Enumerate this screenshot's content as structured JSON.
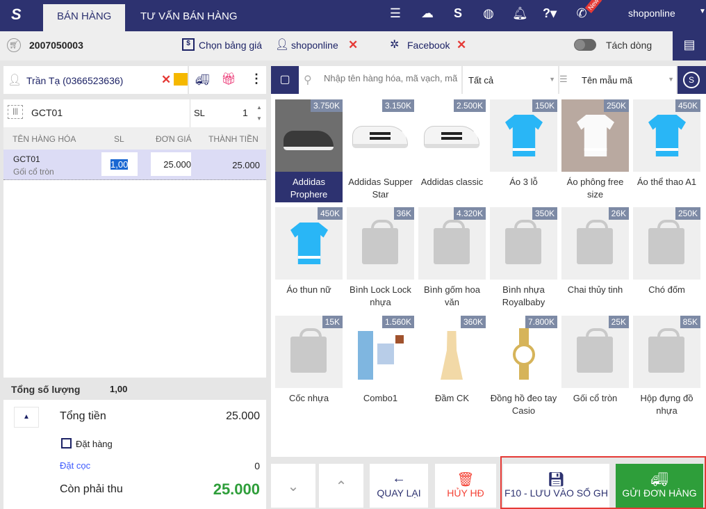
{
  "header": {
    "tabs": [
      "BÁN HÀNG",
      "TƯ VẤN BÁN HÀNG"
    ],
    "user": "shoponline",
    "new_badge": "New"
  },
  "toolbar": {
    "order_code": "2007050003",
    "price_list": "Chọn bảng giá",
    "seller": "shoponline",
    "channel": "Facebook",
    "split_lines": "Tách dòng",
    "split_lines_on": false
  },
  "customer": {
    "name": "Trần Tạ (0366523636)"
  },
  "scan": {
    "value": "GCT01",
    "qty_label": "SL",
    "qty": "1"
  },
  "table": {
    "headers": [
      "TÊN HÀNG HÓA",
      "SL",
      "ĐƠN GIÁ",
      "THÀNH TIỀN"
    ],
    "rows": [
      {
        "code": "GCT01",
        "name": "Gối cổ tròn",
        "qty": "1,00",
        "price": "25.000",
        "total": "25.000"
      }
    ]
  },
  "summary": {
    "total_qty_label": "Tổng số lượng",
    "total_qty": "1,00",
    "total_label": "Tổng tiền",
    "total": "25.000",
    "order_label": "Đặt hàng",
    "deposit_label": "Đặt cọc",
    "deposit": "0",
    "due_label": "Còn phải thu",
    "due": "25.000"
  },
  "search": {
    "placeholder": "Nhập tên hàng hóa, mã vạch, mã",
    "category": "Tất cả",
    "sort": "Tên mẫu mã"
  },
  "products": [
    {
      "name": "Addidas Prophere",
      "price": "3.750K",
      "img": "shoe-dark"
    },
    {
      "name": "Addidas Supper Star",
      "price": "3.150K",
      "img": "shoe"
    },
    {
      "name": "Addidas classic",
      "price": "2.500K",
      "img": "shoe"
    },
    {
      "name": "Áo 3 lỗ",
      "price": "150K",
      "img": "shirt"
    },
    {
      "name": "Áo phông free size",
      "price": "250K",
      "img": "tee"
    },
    {
      "name": "Áo thể thao A1",
      "price": "450K",
      "img": "shirt"
    },
    {
      "name": "Áo thun nữ",
      "price": "450K",
      "img": "shirt"
    },
    {
      "name": "Bình Lock Lock nhựa",
      "price": "36K",
      "img": "bag"
    },
    {
      "name": "Bình gốm hoa văn",
      "price": "4.320K",
      "img": "bag"
    },
    {
      "name": "Bình nhựa Royalbaby",
      "price": "350K",
      "img": "bag"
    },
    {
      "name": "Chai thủy tinh",
      "price": "26K",
      "img": "bag"
    },
    {
      "name": "Chó đốm",
      "price": "250K",
      "img": "bag"
    },
    {
      "name": "Cốc nhựa",
      "price": "15K",
      "img": "bag"
    },
    {
      "name": "Combo1",
      "price": "1.560K",
      "img": "combo"
    },
    {
      "name": "Đầm CK",
      "price": "360K",
      "img": "dress"
    },
    {
      "name": "Đồng hồ đeo tay Casio",
      "price": "7.800K",
      "img": "watch"
    },
    {
      "name": "Gối cổ tròn",
      "price": "25K",
      "img": "bag"
    },
    {
      "name": "Hộp đựng đồ nhựa",
      "price": "85K",
      "img": "bag"
    }
  ],
  "actions": {
    "back": "QUAY LẠI",
    "cancel": "HỦY HĐ",
    "save": "F10 - LƯU VÀO SỔ GH",
    "send": "GỬI ĐƠN HÀNG"
  }
}
